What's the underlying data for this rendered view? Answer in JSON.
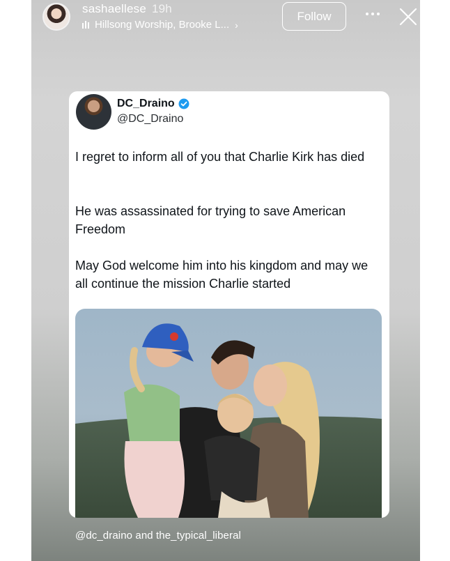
{
  "story_header": {
    "username": "sashaellese",
    "time_ago": "19h",
    "music": "Hillsong Worship, Brooke L...",
    "follow_label": "Follow"
  },
  "tweet": {
    "display_name": "DC_Draino",
    "handle": "@DC_Draino",
    "paragraphs": [
      "I regret to inform all of you that Charlie Kirk has died",
      "He was assassinated for trying to save American Freedom",
      "May God welcome him into his kingdom and may we all continue the mission Charlie started"
    ],
    "verified_color": "#1d9bf0"
  },
  "mentions": {
    "user1": "@dc_draino",
    "joiner": "and",
    "user2": "the_typical_liberal"
  },
  "icons": {
    "music": "audio-bars-icon",
    "more": "more-dots-icon",
    "close": "close-icon",
    "verified": "verified-badge-icon"
  }
}
